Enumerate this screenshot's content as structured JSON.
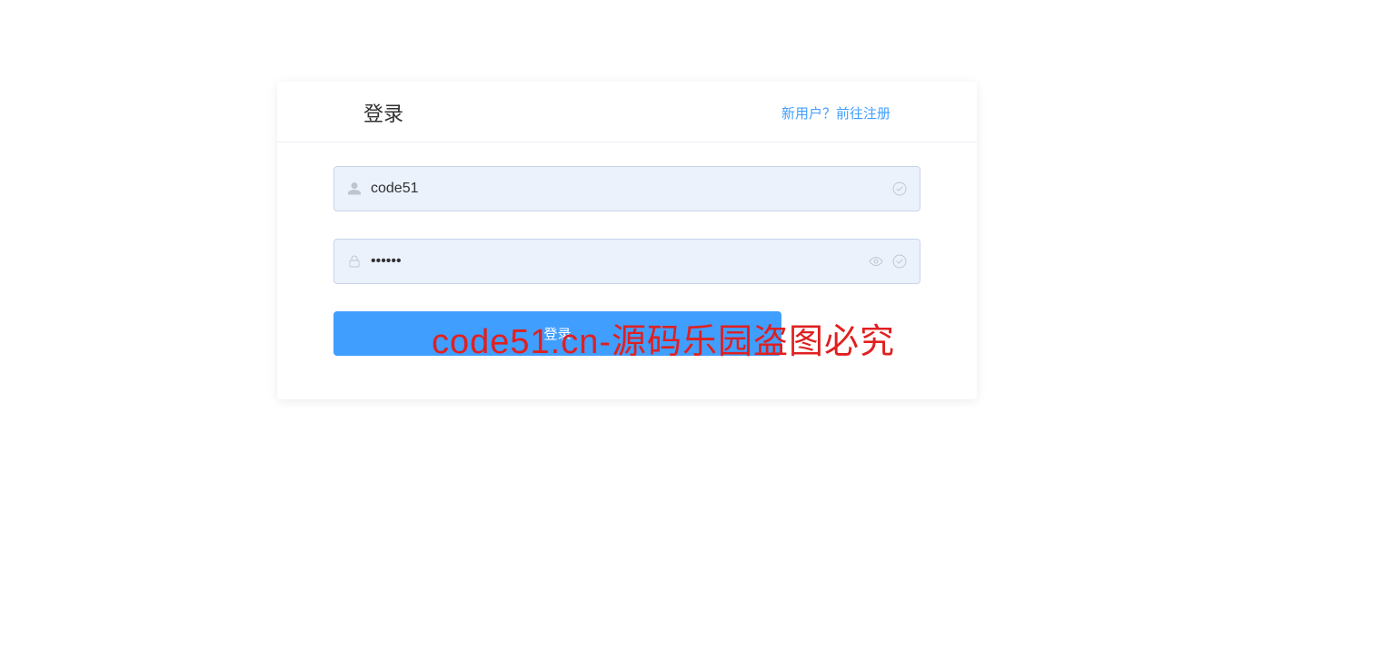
{
  "header": {
    "title": "登录",
    "register_prompt": "新用户？前往注册"
  },
  "form": {
    "username": {
      "value": "code51",
      "placeholder": ""
    },
    "password": {
      "value": "••••••",
      "placeholder": ""
    },
    "submit_label": "登录"
  },
  "watermark": "code51.cn-源码乐园盗图必究"
}
